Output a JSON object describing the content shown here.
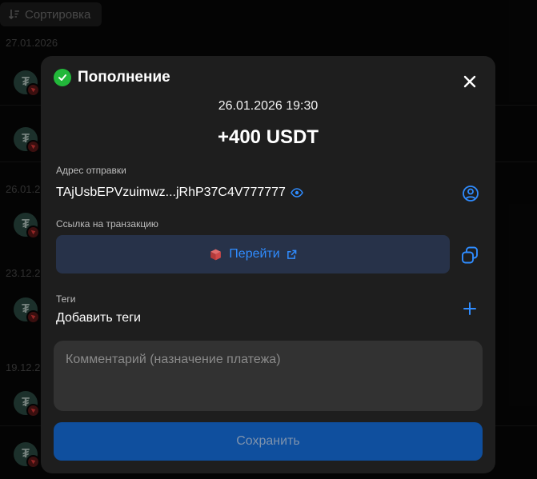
{
  "background": {
    "sort_label": "Сортировка",
    "date_groups": [
      "27.01.2026",
      "26.01.2",
      "23.12.2",
      "19.12.2"
    ]
  },
  "modal": {
    "title": "Пополнение",
    "datetime": "26.01.2026 19:30",
    "amount": "+400 USDT",
    "sender_label": "Адрес отправки",
    "sender_address": "TAjUsbEPVzuimwz...jRhP37C4V777777",
    "tx_link_label": "Ссылка на транзакцию",
    "goto_label": "Перейти",
    "tags_label": "Теги",
    "tags_value": "Добавить теги",
    "comment_placeholder": "Комментарий (назначение платежа)",
    "save_label": "Сохранить"
  },
  "icons": {
    "status": "check-circle-icon",
    "close": "close-icon",
    "eye": "eye-icon",
    "contact": "user-circle-icon",
    "explorer": "cube-icon",
    "external": "external-link-icon",
    "copy": "copy-icon",
    "add": "plus-icon",
    "sort": "sort-icon",
    "token": "tether-icon",
    "network": "tron-icon"
  },
  "colors": {
    "accent": "#2f8cff",
    "success": "#22b83a",
    "modal_bg": "#1e1e1e",
    "button_bg": "#273249",
    "save_bg": "#0f4f9e"
  }
}
